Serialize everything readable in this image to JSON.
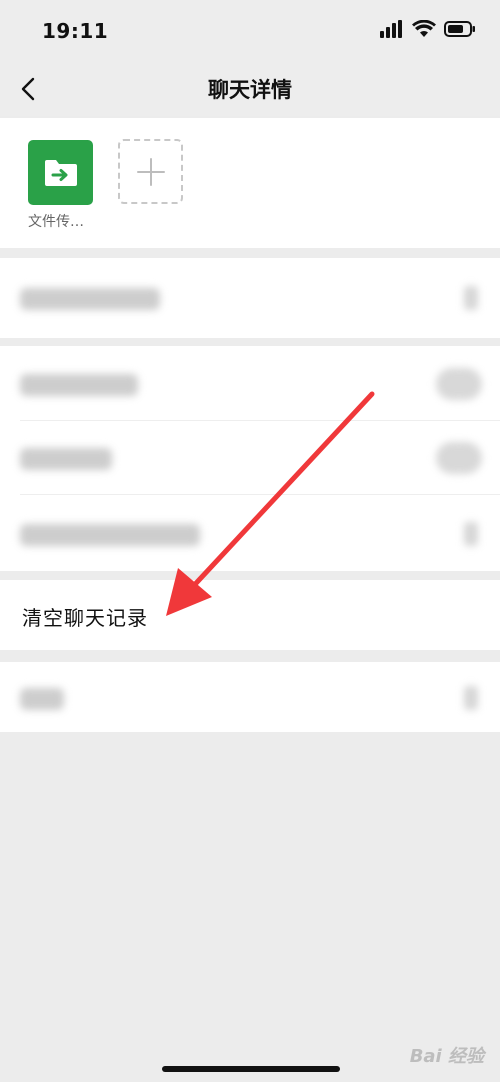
{
  "status_bar": {
    "time": "19:11"
  },
  "nav": {
    "title": "聊天详情"
  },
  "members": [
    {
      "name": "文件传…",
      "icon": "folder-transfer-icon"
    }
  ],
  "actions": {
    "clear_history_label": "清空聊天记录"
  },
  "watermark": "Bai 经验",
  "colors": {
    "accent_green": "#2aa148",
    "annotation_arrow": "#f0383a",
    "background": "#ececec"
  }
}
